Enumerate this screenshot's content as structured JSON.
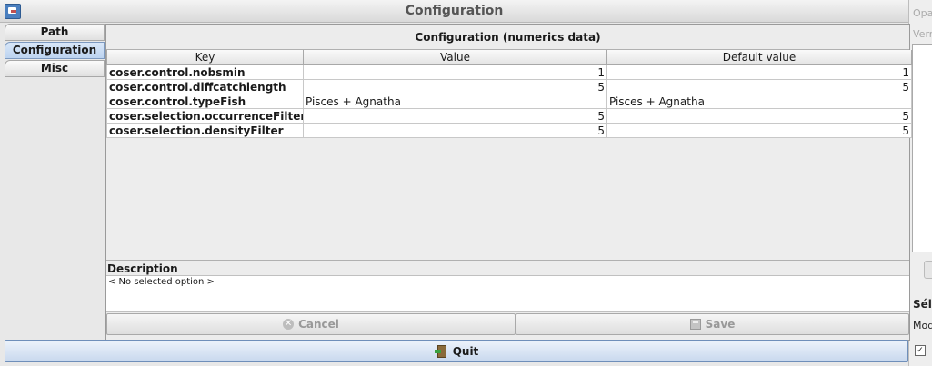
{
  "window": {
    "title": "Configuration"
  },
  "background_window": {
    "line1": "Opa",
    "line2": "Verr",
    "line3": "Sélé",
    "line4": "Mod"
  },
  "side_tabs": [
    {
      "label": "Path",
      "active": false
    },
    {
      "label": "Configuration",
      "active": true
    },
    {
      "label": "Misc",
      "active": false
    }
  ],
  "panel": {
    "title": "Configuration (numerics data)",
    "columns": [
      "Key",
      "Value",
      "Default value"
    ],
    "rows": [
      {
        "key": "coser.control.nobsmin",
        "value": "1",
        "default": "1"
      },
      {
        "key": "coser.control.diffcatchlength",
        "value": "5",
        "default": "5"
      },
      {
        "key": "coser.control.typeFish",
        "value": "Pisces + Agnatha",
        "default": "Pisces + Agnatha"
      },
      {
        "key": "coser.selection.occurrenceFilter",
        "value": "5",
        "default": "5"
      },
      {
        "key": "coser.selection.densityFilter",
        "value": "5",
        "default": "5"
      }
    ],
    "description_label": "Description",
    "description_text": "< No selected option >",
    "cancel_label": "Cancel",
    "save_label": "Save"
  },
  "quit_label": "Quit",
  "icons": {
    "app": "app-window-icon",
    "cancel": "cancel-circle-icon",
    "save": "floppy-disk-icon",
    "quit": "exit-door-icon"
  }
}
